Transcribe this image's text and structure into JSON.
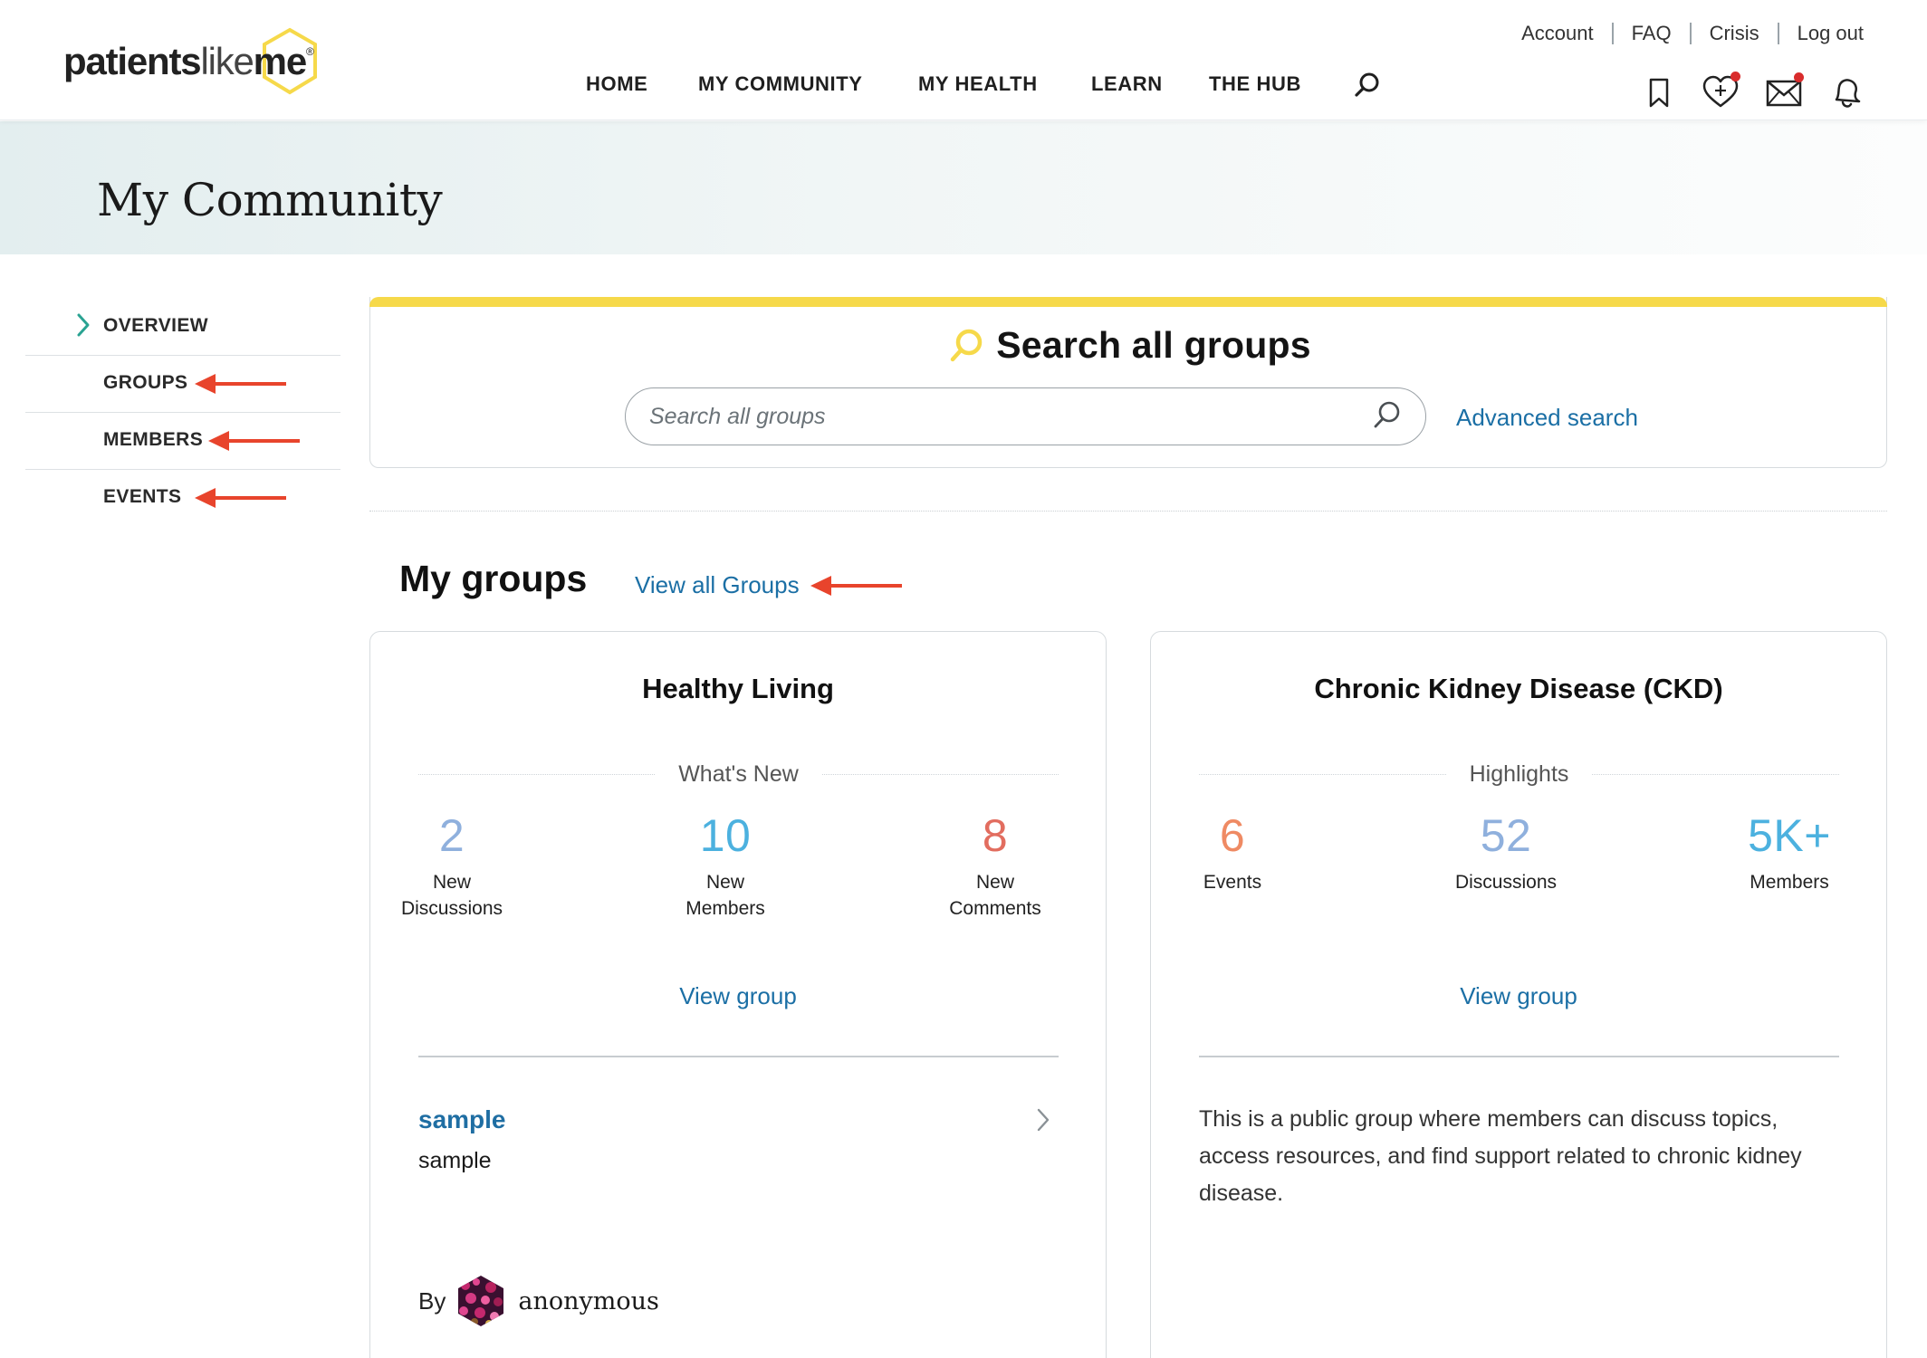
{
  "logo": {
    "part_bold": "patients",
    "part_light": "like",
    "part_bold2": "me",
    "reg": "®"
  },
  "utility_nav": {
    "account": "Account",
    "faq": "FAQ",
    "crisis": "Crisis",
    "logout": "Log out"
  },
  "main_nav": {
    "home": "HOME",
    "community": "MY COMMUNITY",
    "health": "MY HEALTH",
    "learn": "LEARN",
    "hub": "THE HUB"
  },
  "header_icons": [
    "bookmark-icon",
    "heart-plus-icon",
    "mail-icon",
    "bell-icon"
  ],
  "page": {
    "title": "My Community"
  },
  "sidebar": {
    "items": [
      {
        "label": "OVERVIEW",
        "active": true
      },
      {
        "label": "GROUPS",
        "active": false
      },
      {
        "label": "MEMBERS",
        "active": false
      },
      {
        "label": "EVENTS",
        "active": false
      }
    ]
  },
  "search": {
    "title": "Search all groups",
    "placeholder": "Search all groups",
    "value": "",
    "advanced": "Advanced search"
  },
  "my_groups": {
    "title": "My groups",
    "view_all": "View all Groups",
    "cards": [
      {
        "title": "Healthy Living",
        "subtitle": "What's New",
        "stats": [
          {
            "value": "2",
            "label1": "New",
            "label2": "Discussions",
            "color": "#8fb0dd"
          },
          {
            "value": "10",
            "label1": "New",
            "label2": "Members",
            "color": "#4cb1df"
          },
          {
            "value": "8",
            "label1": "New",
            "label2": "Comments",
            "color": "#e26d5f"
          }
        ],
        "view_group": "View group",
        "post": {
          "title": "sample",
          "body": "sample",
          "by": "By",
          "author": "anonymous"
        }
      },
      {
        "title": "Chronic Kidney Disease (CKD)",
        "subtitle": "Highlights",
        "stats": [
          {
            "value": "6",
            "label1": "Events",
            "color": "#ef8a63"
          },
          {
            "value": "52",
            "label1": "Discussions",
            "color": "#8fb0dd"
          },
          {
            "value": "5K+",
            "label1": "Members",
            "color": "#4cb1df"
          }
        ],
        "view_group": "View group",
        "description": "This is a public group where members can discuss topics, access resources, and find support related to chronic kidney disease."
      }
    ]
  },
  "colors": {
    "accent_yellow": "#f6d94a",
    "link_blue": "#1b6fa5",
    "annotation_red": "#e8442c",
    "teal_chevron": "#2aa392"
  }
}
